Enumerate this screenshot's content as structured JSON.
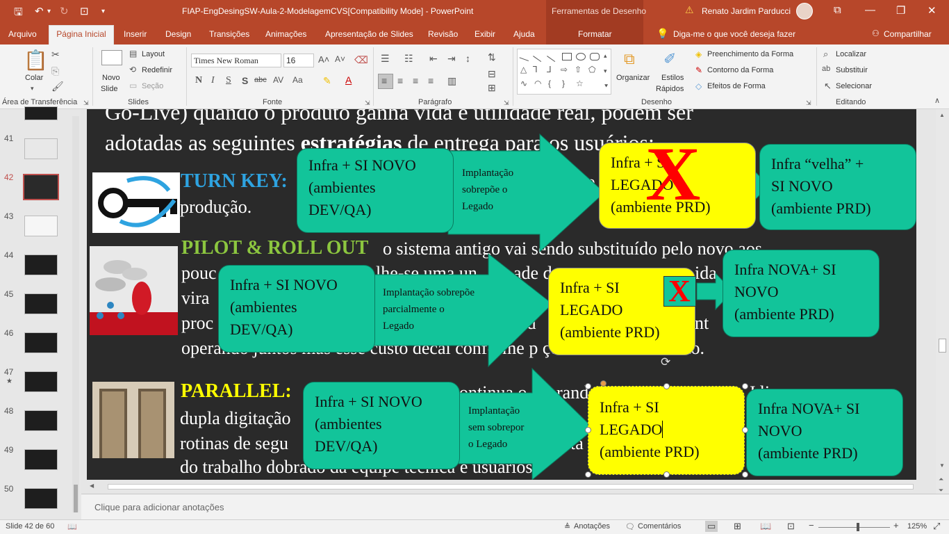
{
  "titlebar": {
    "doc_title": "FIAP-EngDesingSW-Aula-2-ModelagemCVS[Compatibility Mode]  -  PowerPoint",
    "drawing_tools": "Ferramentas de Desenho",
    "user_name": "Renato Jardim Parducci"
  },
  "tabs": [
    "Arquivo",
    "Página Inicial",
    "Inserir",
    "Design",
    "Transições",
    "Animações",
    "Apresentação de Slides",
    "Revisão",
    "Exibir",
    "Ajuda",
    "Formatar"
  ],
  "tell_me": "Diga-me o que você deseja fazer",
  "share": "Compartilhar",
  "ribbon": {
    "clipboard": {
      "paste": "Colar",
      "group": "Área de Transferência"
    },
    "slides": {
      "new_slide": [
        "Novo",
        "Slide"
      ],
      "layout": "Layout",
      "reset": "Redefinir",
      "section": "Seção",
      "group": "Slides"
    },
    "font": {
      "name": "Times New Roman",
      "size": "16",
      "group": "Fonte"
    },
    "paragraph": {
      "group": "Parágrafo"
    },
    "drawing": {
      "arrange": "Organizar",
      "quick_styles": [
        "Estilos",
        "Rápidos"
      ],
      "fill": "Preenchimento da Forma",
      "outline": "Contorno da Forma",
      "effects": "Efeitos de Forma",
      "group": "Desenho"
    },
    "editing": {
      "find": "Localizar",
      "replace": "Substituir",
      "select": "Selecionar",
      "group": "Editando"
    }
  },
  "thumbnails": [
    "41",
    "42",
    "43",
    "44",
    "45",
    "46",
    "47",
    "48",
    "49",
    "50"
  ],
  "slide": {
    "intro_line1": "Go-Live) quando o produto ganha vida e utilidade real, podem ser",
    "intro_line2_pre": "adotadas as seguintes ",
    "intro_line2_bold": "estratégias",
    "intro_line2_post": " de entrega para os usuários:",
    "turnkey_head": "TURN KEY:",
    "turnkey_tail": "e",
    "turnkey_line2": "produção.",
    "pilot_head": "PILOT & ROLL OUT",
    "pilot_l1": "o sistema antigo vai sendo substituído pelo novo aos",
    "pilot_l2a": "pouc",
    "pilot_l2b": "lhe-se uma un",
    "pilot_l2c": "ade d",
    "pilot_l2d": "ida",
    "pilot_l3a": "vira",
    "pilot_l3b": "de",
    "pilot_l4a": "proc",
    "pilot_l4b": "o d",
    "pilot_l4c": "nt",
    "pilot_l5": "operando juntos mas esse custo decai conforme    p    ções vão acontecendo.",
    "parallel_head": "PARALLEL:",
    "parallel_l1a": "ontinua o",
    "parallel_l1b": "rand",
    "parallel_l1c": "J   li",
    "parallel_l2": "dupla digitação",
    "parallel_l3": "rotinas de segu",
    "parallel_l3b": "ta",
    "parallel_l4": "do trabalho dobrado da equipe técnica e usuários",
    "row1": {
      "box1": [
        "Infra + SI NOVO",
        "(ambientes",
        "DEV/QA)"
      ],
      "arrow_label": [
        "Implantação",
        "sobrepõe o",
        "Legado"
      ],
      "box2": [
        "Infra + SI",
        "LEGADO",
        "(ambiente PRD)"
      ],
      "mark": "X",
      "box3": [
        "Infra “velha” +",
        "SI NOVO",
        "(ambiente PRD)"
      ]
    },
    "row2": {
      "box1": [
        "Infra + SI NOVO",
        "(ambientes",
        "DEV/QA)"
      ],
      "arrow_label": [
        "Implantação sobrepõe",
        "parcialmente o",
        "Legado"
      ],
      "box2": [
        "Infra + SI",
        "LEGADO",
        "(ambiente PRD)"
      ],
      "mark": "X",
      "box3": [
        "Infra NOVA+ SI",
        "NOVO",
        "(ambiente PRD)"
      ]
    },
    "row3": {
      "box1": [
        "Infra + SI NOVO",
        "(ambientes",
        "DEV/QA)"
      ],
      "arrow_label": [
        "Implantação",
        "sem sobrepor",
        "o Legado"
      ],
      "box2": [
        "Infra + SI",
        "LEGADO",
        "(ambiente PRD)"
      ],
      "box3": [
        "Infra NOVA+ SI",
        "NOVO",
        "(ambiente PRD)"
      ]
    }
  },
  "notes_placeholder": "Clique para adicionar anotações",
  "status": {
    "slide_info": "Slide 42 de 60",
    "notes": "Anotações",
    "comments": "Comentários",
    "zoom": "125%"
  },
  "colors": {
    "accent": "#b7472a",
    "slide_bg": "#2a2a2a",
    "green_box": "#12c49a",
    "yellow_box": "#ffff00",
    "turnkey": "#2ea3e0",
    "pilot": "#8cc63f",
    "parallel": "#ffff00",
    "mark": "#ff0000"
  }
}
